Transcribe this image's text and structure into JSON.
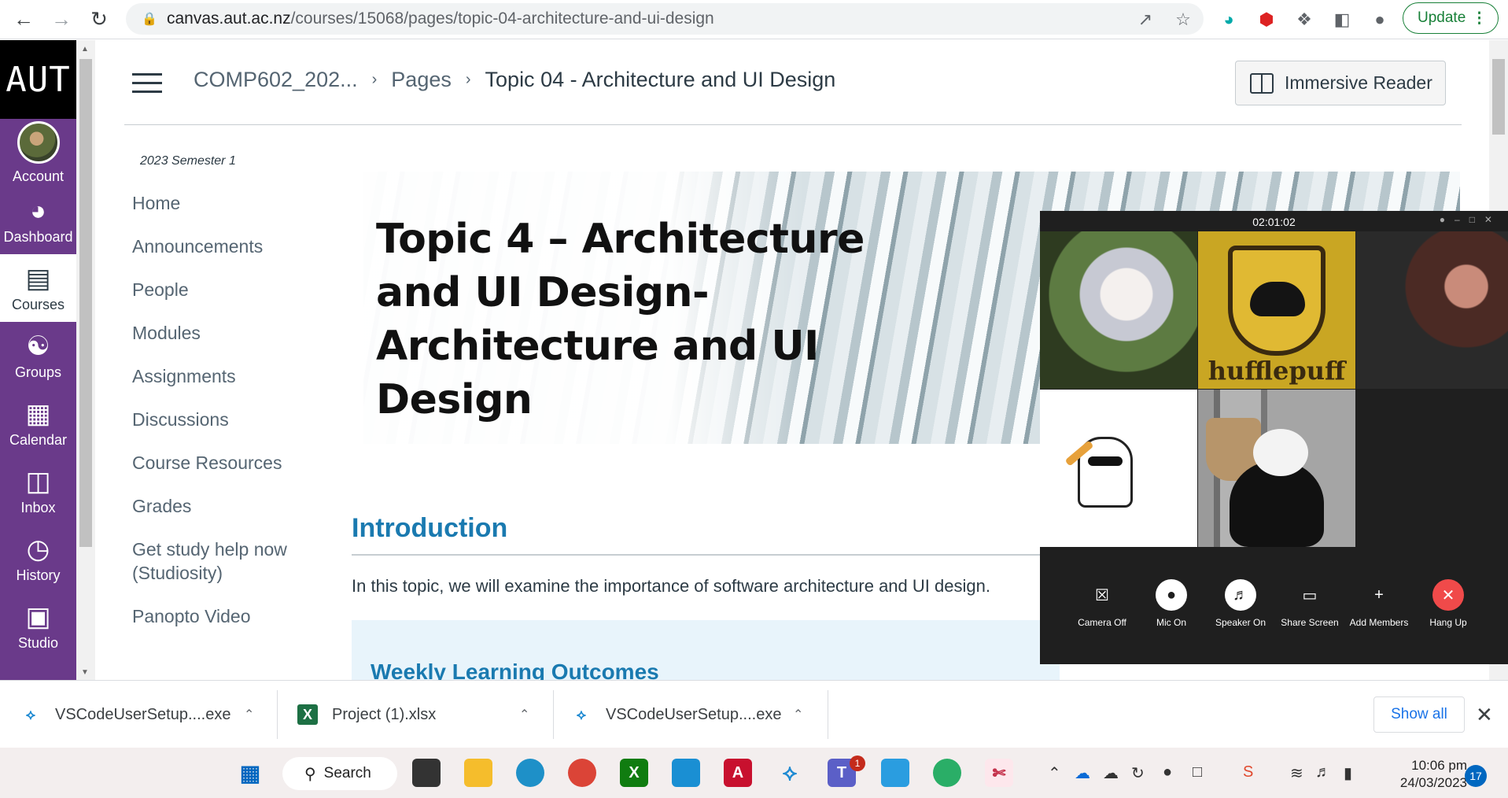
{
  "browser": {
    "url_host": "canvas.aut.ac.nz",
    "url_path": "/courses/15068/pages/topic-04-architecture-and-ui-design",
    "update_label": "Update"
  },
  "global_nav": {
    "logo": "AUT",
    "items": [
      {
        "label": "Account",
        "icon": "avatar"
      },
      {
        "label": "Dashboard",
        "icon": "gauge-icon"
      },
      {
        "label": "Courses",
        "icon": "book-icon"
      },
      {
        "label": "Groups",
        "icon": "people-icon"
      },
      {
        "label": "Calendar",
        "icon": "calendar-icon"
      },
      {
        "label": "Inbox",
        "icon": "inbox-icon"
      },
      {
        "label": "History",
        "icon": "clock-icon"
      },
      {
        "label": "Studio",
        "icon": "studio-icon"
      }
    ]
  },
  "header": {
    "crumbs": [
      "COMP602_202...",
      "Pages"
    ],
    "current": "Topic 04 - Architecture and UI Design",
    "immersive_reader": "Immersive Reader"
  },
  "course_nav": {
    "semester": "2023 Semester 1",
    "items": [
      "Home",
      "Announcements",
      "People",
      "Modules",
      "Assignments",
      "Discussions",
      "Course Resources",
      "Grades",
      "Get study help now (Studiosity)",
      "Panopto Video"
    ]
  },
  "content": {
    "banner_title": "Topic 4 – Architecture and UI Design- Architecture and UI Design",
    "intro_heading": "Introduction",
    "intro_text": "In this topic, we will examine the importance of software architecture and UI design.",
    "outcomes_heading": "Weekly Learning Outcomes"
  },
  "call": {
    "timer": "02:01:02",
    "tile_text": "hufflepuff",
    "buttons": [
      "Camera Off",
      "Mic On",
      "Speaker On",
      "Share Screen",
      "Add Members",
      "Hang Up"
    ]
  },
  "downloads": {
    "items": [
      "VSCodeUserSetup....exe",
      "Project (1).xlsx",
      "VSCodeUserSetup....exe"
    ],
    "show_all": "Show all"
  },
  "taskbar": {
    "search": "Search",
    "teams_badge": "1",
    "time": "10:06 pm",
    "date": "24/03/2023",
    "notifications": "17"
  }
}
